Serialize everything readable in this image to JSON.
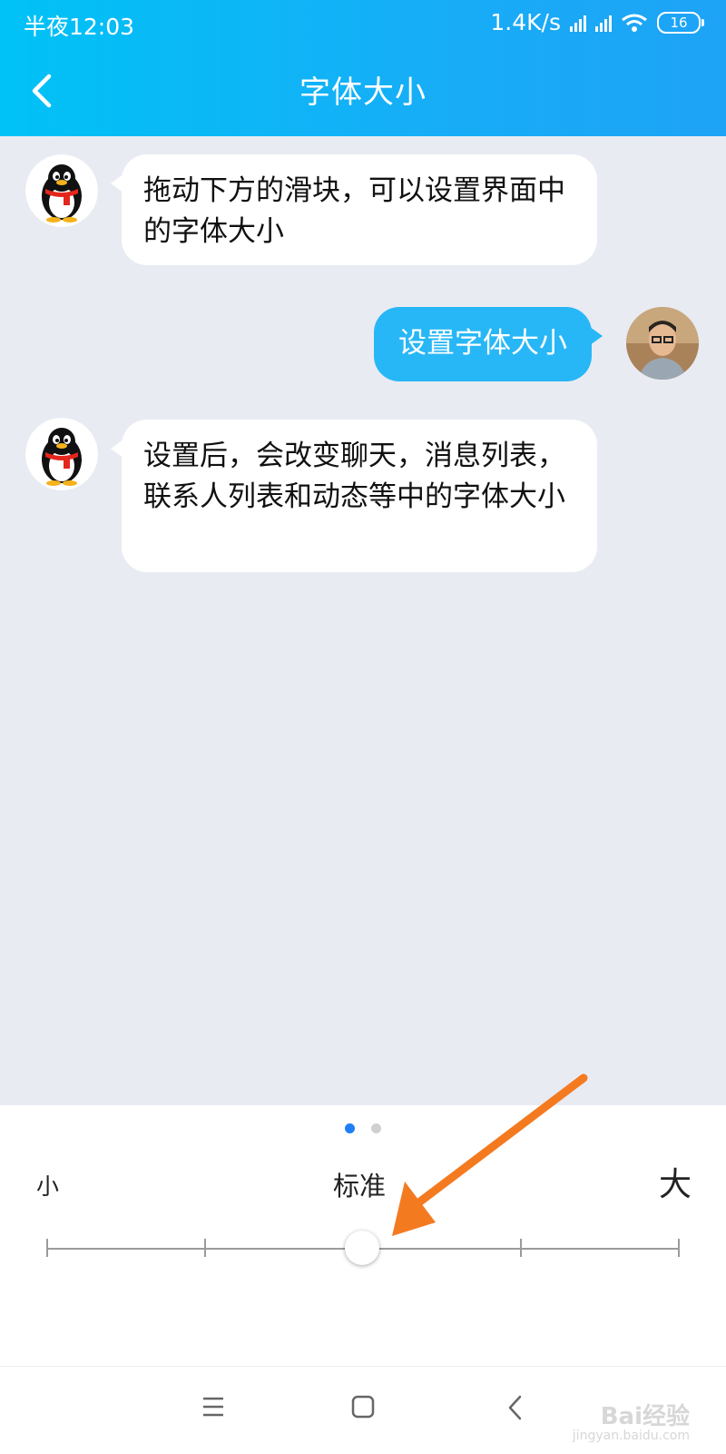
{
  "status_bar": {
    "time": "半夜12:03",
    "net_speed": "1.4K/s",
    "battery": "16"
  },
  "header": {
    "title": "字体大小"
  },
  "chat": {
    "messages": [
      {
        "side": "left",
        "text": "拖动下方的滑块，可以设置界面中的字体大小"
      },
      {
        "side": "right",
        "text": "设置字体大小"
      },
      {
        "side": "left",
        "text": "设置后，会改变聊天，消息列表，联系人列表和动态等中的字体大小"
      }
    ]
  },
  "font_size": {
    "label_small": "小",
    "label_standard": "标准",
    "label_large": "大",
    "levels": 5,
    "selected_level": 3,
    "page_indicator": {
      "count": 2,
      "active": 1
    }
  },
  "watermark": {
    "text": "Bai经验",
    "url": "jingyan.baidu.com"
  },
  "colors": {
    "header_start": "#00c2f6",
    "header_end": "#1ea3f6",
    "chat_background": "#e9ebf3",
    "sent_bubble": "#28b7f6",
    "annotation_arrow": "#f47a20"
  }
}
